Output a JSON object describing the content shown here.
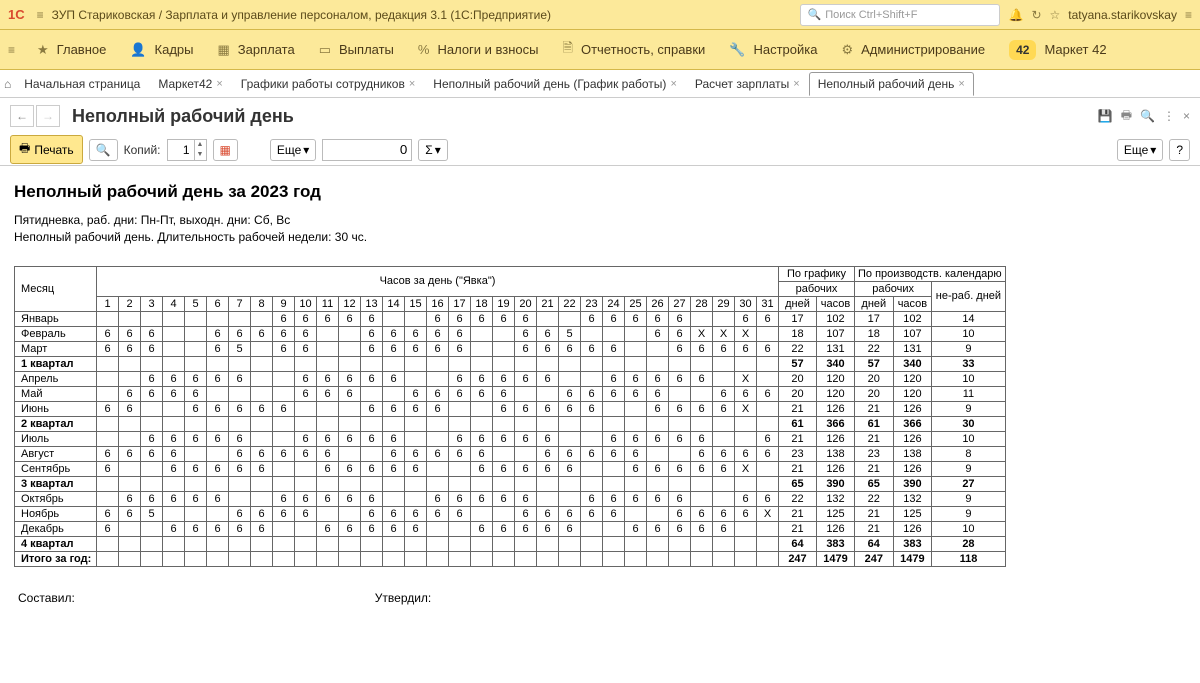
{
  "titlebar": {
    "app_title": "ЗУП Стариковская / Зарплата и управление персоналом, редакция 3.1 (1С:Предприятие)",
    "search_placeholder": "Поиск Ctrl+Shift+F",
    "username": "tatyana.starikovskay"
  },
  "mainmenu": {
    "items": [
      "Главное",
      "Кадры",
      "Зарплата",
      "Выплаты",
      "Налоги и взносы",
      "Отчетность, справки",
      "Настройка",
      "Администрирование",
      "Маркет 42"
    ],
    "market_badge": "42"
  },
  "tabs": {
    "home": "Начальная страница",
    "items": [
      "Маркет42",
      "Графики работы сотрудников",
      "Неполный рабочий день (График работы)",
      "Расчет зарплаты",
      "Неполный рабочий день"
    ],
    "active_index": 4
  },
  "page": {
    "title": "Неполный рабочий день"
  },
  "toolbar": {
    "print": "Печать",
    "copies_label": "Копий:",
    "copies_value": "1",
    "more": "Еще",
    "num_input": "0",
    "sigma": "Σ",
    "more_right": "Еще",
    "help": "?"
  },
  "report": {
    "title": "Неполный рабочий день за 2023 год",
    "sub1": "Пятидневка, раб. дни: Пн-Пт, выходн. дни: Сб, Вс",
    "sub2": "Неполный рабочий день. Длительность рабочей недели: 30 чс.",
    "col_month": "Месяц",
    "col_hours_header": "Часов за день (\"Явка\")",
    "col_schedule": "По графику",
    "col_prod": "По производств. календарю",
    "col_work": "рабочих",
    "col_days": "дней",
    "col_hours": "часов",
    "col_nonwork": "не-раб. дней",
    "footer_compiled": "Составил:",
    "footer_approved": "Утвердил:"
  },
  "chart_data": {
    "type": "table",
    "day_headers": [
      "1",
      "2",
      "3",
      "4",
      "5",
      "6",
      "7",
      "8",
      "9",
      "10",
      "11",
      "12",
      "13",
      "14",
      "15",
      "16",
      "17",
      "18",
      "19",
      "20",
      "21",
      "22",
      "23",
      "24",
      "25",
      "26",
      "27",
      "28",
      "29",
      "30",
      "31"
    ],
    "rows": [
      {
        "label": "Январь",
        "days": [
          "",
          "",
          "",
          "",
          "",
          "",
          "",
          "",
          "6",
          "6",
          "6",
          "6",
          "6",
          "",
          "",
          "6",
          "6",
          "6",
          "6",
          "6",
          "",
          "",
          "6",
          "6",
          "6",
          "6",
          "6",
          "",
          "",
          "6",
          "6"
        ],
        "sd": "17",
        "sh": "102",
        "pd": "17",
        "ph": "102",
        "nr": "14"
      },
      {
        "label": "Февраль",
        "days": [
          "6",
          "6",
          "6",
          "",
          "",
          "6",
          "6",
          "6",
          "6",
          "6",
          "",
          "",
          "6",
          "6",
          "6",
          "6",
          "6",
          "",
          "",
          "6",
          "6",
          "5",
          "",
          "",
          "",
          "6",
          "6",
          "X",
          "X",
          "X",
          ""
        ],
        "sd": "18",
        "sh": "107",
        "pd": "18",
        "ph": "107",
        "nr": "10"
      },
      {
        "label": "Март",
        "days": [
          "6",
          "6",
          "6",
          "",
          "",
          "6",
          "5",
          "",
          "6",
          "6",
          "",
          "",
          "6",
          "6",
          "6",
          "6",
          "6",
          "",
          "",
          "6",
          "6",
          "6",
          "6",
          "6",
          "",
          "",
          "6",
          "6",
          "6",
          "6",
          "6"
        ],
        "sd": "22",
        "sh": "131",
        "pd": "22",
        "ph": "131",
        "nr": "9"
      },
      {
        "label": "1 квартал",
        "bold": true,
        "days": [
          "",
          "",
          "",
          "",
          "",
          "",
          "",
          "",
          "",
          "",
          "",
          "",
          "",
          "",
          "",
          "",
          "",
          "",
          "",
          "",
          "",
          "",
          "",
          "",
          "",
          "",
          "",
          "",
          "",
          "",
          ""
        ],
        "sd": "57",
        "sh": "340",
        "pd": "57",
        "ph": "340",
        "nr": "33"
      },
      {
        "label": "Апрель",
        "days": [
          "",
          "",
          "6",
          "6",
          "6",
          "6",
          "6",
          "",
          "",
          "6",
          "6",
          "6",
          "6",
          "6",
          "",
          "",
          "6",
          "6",
          "6",
          "6",
          "6",
          "",
          "",
          "6",
          "6",
          "6",
          "6",
          "6",
          "",
          "X",
          ""
        ],
        "sd": "20",
        "sh": "120",
        "pd": "20",
        "ph": "120",
        "nr": "10"
      },
      {
        "label": "Май",
        "days": [
          "",
          "6",
          "6",
          "6",
          "6",
          "",
          "",
          "",
          "",
          "6",
          "6",
          "6",
          "",
          "",
          "6",
          "6",
          "6",
          "6",
          "6",
          "",
          "",
          "6",
          "6",
          "6",
          "6",
          "6",
          "",
          "",
          "6",
          "6",
          "6"
        ],
        "sd": "20",
        "sh": "120",
        "pd": "20",
        "ph": "120",
        "nr": "11"
      },
      {
        "label": "Июнь",
        "days": [
          "6",
          "6",
          "",
          "",
          "6",
          "6",
          "6",
          "6",
          "6",
          "",
          "",
          "",
          "6",
          "6",
          "6",
          "6",
          "",
          "",
          "6",
          "6",
          "6",
          "6",
          "6",
          "",
          "",
          "6",
          "6",
          "6",
          "6",
          "X",
          ""
        ],
        "sd": "21",
        "sh": "126",
        "pd": "21",
        "ph": "126",
        "nr": "9"
      },
      {
        "label": "2 квартал",
        "bold": true,
        "days": [
          "",
          "",
          "",
          "",
          "",
          "",
          "",
          "",
          "",
          "",
          "",
          "",
          "",
          "",
          "",
          "",
          "",
          "",
          "",
          "",
          "",
          "",
          "",
          "",
          "",
          "",
          "",
          "",
          "",
          "",
          ""
        ],
        "sd": "61",
        "sh": "366",
        "pd": "61",
        "ph": "366",
        "nr": "30"
      },
      {
        "label": "Июль",
        "days": [
          "",
          "",
          "6",
          "6",
          "6",
          "6",
          "6",
          "",
          "",
          "6",
          "6",
          "6",
          "6",
          "6",
          "",
          "",
          "6",
          "6",
          "6",
          "6",
          "6",
          "",
          "",
          "6",
          "6",
          "6",
          "6",
          "6",
          "",
          "",
          "6"
        ],
        "sd": "21",
        "sh": "126",
        "pd": "21",
        "ph": "126",
        "nr": "10"
      },
      {
        "label": "Август",
        "days": [
          "6",
          "6",
          "6",
          "6",
          "",
          "",
          "6",
          "6",
          "6",
          "6",
          "6",
          "",
          "",
          "6",
          "6",
          "6",
          "6",
          "6",
          "",
          "",
          "6",
          "6",
          "6",
          "6",
          "6",
          "",
          "",
          "6",
          "6",
          "6",
          "6"
        ],
        "sd": "23",
        "sh": "138",
        "pd": "23",
        "ph": "138",
        "nr": "8"
      },
      {
        "label": "Сентябрь",
        "days": [
          "6",
          "",
          "",
          "6",
          "6",
          "6",
          "6",
          "6",
          "",
          "",
          "6",
          "6",
          "6",
          "6",
          "6",
          "",
          "",
          "6",
          "6",
          "6",
          "6",
          "6",
          "",
          "",
          "6",
          "6",
          "6",
          "6",
          "6",
          "X",
          ""
        ],
        "sd": "21",
        "sh": "126",
        "pd": "21",
        "ph": "126",
        "nr": "9"
      },
      {
        "label": "3 квартал",
        "bold": true,
        "days": [
          "",
          "",
          "",
          "",
          "",
          "",
          "",
          "",
          "",
          "",
          "",
          "",
          "",
          "",
          "",
          "",
          "",
          "",
          "",
          "",
          "",
          "",
          "",
          "",
          "",
          "",
          "",
          "",
          "",
          "",
          ""
        ],
        "sd": "65",
        "sh": "390",
        "pd": "65",
        "ph": "390",
        "nr": "27"
      },
      {
        "label": "Октябрь",
        "days": [
          "",
          "6",
          "6",
          "6",
          "6",
          "6",
          "",
          "",
          "6",
          "6",
          "6",
          "6",
          "6",
          "",
          "",
          "6",
          "6",
          "6",
          "6",
          "6",
          "",
          "",
          "6",
          "6",
          "6",
          "6",
          "6",
          "",
          "",
          "6",
          "6"
        ],
        "sd": "22",
        "sh": "132",
        "pd": "22",
        "ph": "132",
        "nr": "9"
      },
      {
        "label": "Ноябрь",
        "days": [
          "6",
          "6",
          "5",
          "",
          "",
          "",
          "6",
          "6",
          "6",
          "6",
          "",
          "",
          "6",
          "6",
          "6",
          "6",
          "6",
          "",
          "",
          "6",
          "6",
          "6",
          "6",
          "6",
          "",
          "",
          "6",
          "6",
          "6",
          "6",
          "X"
        ],
        "sd": "21",
        "sh": "125",
        "pd": "21",
        "ph": "125",
        "nr": "9"
      },
      {
        "label": "Декабрь",
        "days": [
          "6",
          "",
          "",
          "6",
          "6",
          "6",
          "6",
          "6",
          "",
          "",
          "6",
          "6",
          "6",
          "6",
          "6",
          "",
          "",
          "6",
          "6",
          "6",
          "6",
          "6",
          "",
          "",
          "6",
          "6",
          "6",
          "6",
          "6",
          "",
          ""
        ],
        "sd": "21",
        "sh": "126",
        "pd": "21",
        "ph": "126",
        "nr": "10"
      },
      {
        "label": "4 квартал",
        "bold": true,
        "days": [
          "",
          "",
          "",
          "",
          "",
          "",
          "",
          "",
          "",
          "",
          "",
          "",
          "",
          "",
          "",
          "",
          "",
          "",
          "",
          "",
          "",
          "",
          "",
          "",
          "",
          "",
          "",
          "",
          "",
          "",
          ""
        ],
        "sd": "64",
        "sh": "383",
        "pd": "64",
        "ph": "383",
        "nr": "28"
      },
      {
        "label": "Итого за год:",
        "bold": true,
        "days": [
          "",
          "",
          "",
          "",
          "",
          "",
          "",
          "",
          "",
          "",
          "",
          "",
          "",
          "",
          "",
          "",
          "",
          "",
          "",
          "",
          "",
          "",
          "",
          "",
          "",
          "",
          "",
          "",
          "",
          "",
          ""
        ],
        "sd": "247",
        "sh": "1479",
        "pd": "247",
        "ph": "1479",
        "nr": "118"
      }
    ]
  }
}
